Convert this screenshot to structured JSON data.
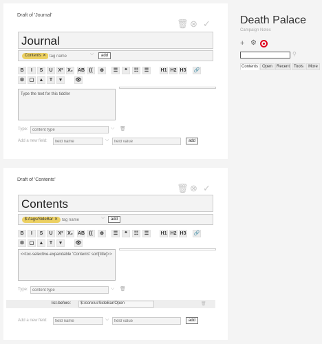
{
  "tiddler1": {
    "draft_label": "Draft of 'Journal'",
    "title_value": "Journal",
    "tag": "Contents",
    "tag_placeholder": "tag name",
    "add_label": "add",
    "editor_text": "Type the text for this tiddler",
    "type_label": "Type:",
    "type_placeholder": "content type",
    "newfield_label": "Add a new field:",
    "field_name_placeholder": "field name",
    "field_value_placeholder": "field value",
    "newfield_add_label": "add"
  },
  "tiddler2": {
    "draft_label": "Draft of 'Contents'",
    "title_value": "Contents",
    "tag": "$:/tags/SideBar",
    "tag_placeholder": "tag name",
    "add_label": "add",
    "editor_text": "<<toc-selective-expandable 'Contents' sort[title]>>",
    "type_label": "Type:",
    "type_placeholder": "content type",
    "field": {
      "name": "list-before:",
      "value": "$:/core/ui/SideBar/Open"
    },
    "newfield_label": "Add a new field:",
    "field_name_placeholder": "field name",
    "field_value_placeholder": "field value",
    "newfield_add_label": "add"
  },
  "toolbar": {
    "row1": [
      "B",
      "I",
      "S",
      "U",
      "X²",
      "X₂",
      "AB",
      "{{",
      "⊕",
      "☰",
      "❝",
      "☷",
      "☰",
      "H1",
      "H2",
      "H3",
      "🔗"
    ],
    "row2": [
      "⚙",
      "▢",
      "▲",
      "T",
      "▾",
      "👁"
    ]
  },
  "sidebar": {
    "title": "Death Palace",
    "subtitle": "Campaign Notes",
    "tabs": [
      "Contents",
      "Open",
      "Recent",
      "Tools",
      "More"
    ],
    "active_tab": "Contents"
  },
  "colors": {
    "tag_pill": "#ecd062",
    "record_icon": "#e0001a",
    "field_row": "#eeeeee"
  }
}
